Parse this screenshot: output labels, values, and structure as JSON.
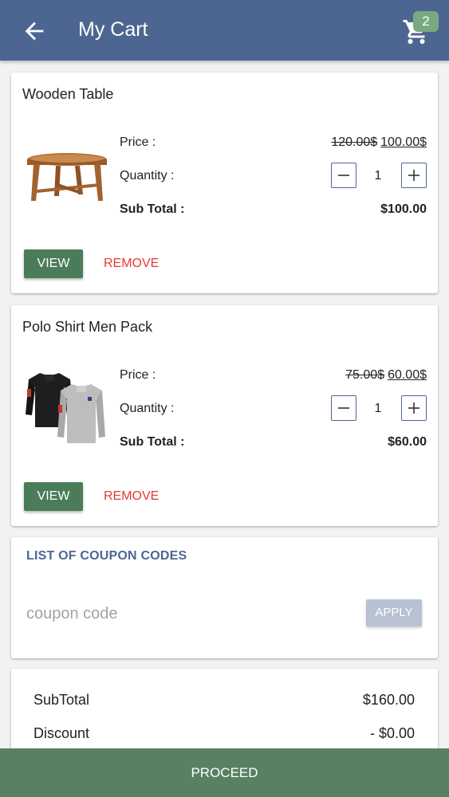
{
  "appbar": {
    "title": "My Cart",
    "cart_count": "2",
    "back_icon": "arrow-back-icon",
    "cart_icon": "shopping-cart-icon"
  },
  "items": [
    {
      "name": "Wooden Table",
      "image": "wooden-table-image",
      "price_label": "Price :",
      "old_price": "120.00$",
      "new_price": "100.00$",
      "quantity_label": "Quantity :",
      "quantity": "1",
      "subtotal_label": "Sub Total :",
      "subtotal": "$100.00",
      "view_label": "VIEW",
      "remove_label": "REMOVE"
    },
    {
      "name": "Polo Shirt Men Pack",
      "image": "polo-shirts-image",
      "price_label": "Price :",
      "old_price": "75.00$",
      "new_price": "60.00$",
      "quantity_label": "Quantity :",
      "quantity": "1",
      "subtotal_label": "Sub Total :",
      "subtotal": "$60.00",
      "view_label": "VIEW",
      "remove_label": "REMOVE"
    }
  ],
  "coupon": {
    "title": "LIST OF COUPON CODES",
    "placeholder": "coupon code",
    "apply_label": "APPLY"
  },
  "summary": {
    "subtotal_label": "SubTotal",
    "subtotal_value": "$160.00",
    "discount_label": "Discount",
    "discount_value": "- $0.00"
  },
  "proceed_label": "PROCEED",
  "colors": {
    "appbar": "#4d6691",
    "button_green": "#4a7c59",
    "remove_red": "#e53935",
    "badge": "#79a983"
  }
}
